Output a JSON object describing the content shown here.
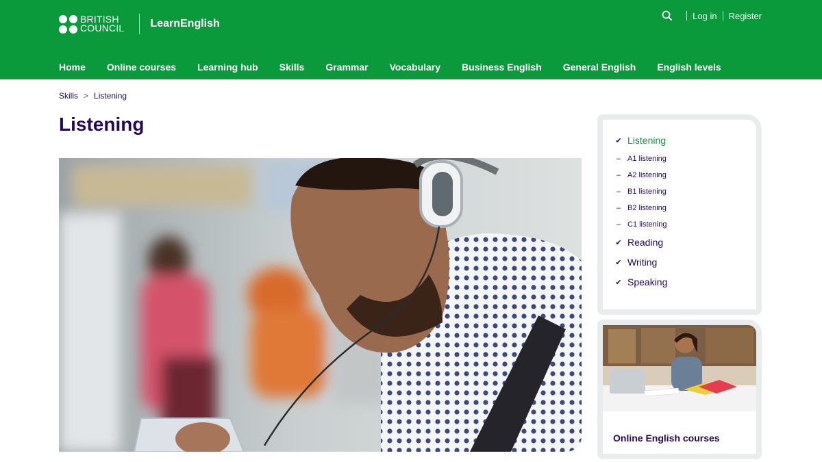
{
  "brand": {
    "logo_line1": "BRITISH",
    "logo_line2": "COUNCIL",
    "site_name": "LearnEnglish"
  },
  "topbar": {
    "login": "Log in",
    "register": "Register"
  },
  "nav": [
    "Home",
    "Online courses",
    "Learning hub",
    "Skills",
    "Grammar",
    "Vocabulary",
    "Business English",
    "General English",
    "English levels"
  ],
  "breadcrumb": {
    "parent": "Skills",
    "separator": ">",
    "current": "Listening"
  },
  "page": {
    "title": "Listening"
  },
  "sidebar": {
    "items": [
      {
        "label": "Listening",
        "type": "main",
        "active": true
      },
      {
        "label": "A1 listening",
        "type": "sub"
      },
      {
        "label": "A2 listening",
        "type": "sub"
      },
      {
        "label": "B1 listening",
        "type": "sub"
      },
      {
        "label": "B2 listening",
        "type": "sub"
      },
      {
        "label": "C1 listening",
        "type": "sub"
      },
      {
        "label": "Reading",
        "type": "main"
      },
      {
        "label": "Writing",
        "type": "main"
      },
      {
        "label": "Speaking",
        "type": "main"
      }
    ]
  },
  "promo": {
    "title": "Online English courses"
  },
  "colors": {
    "brand_green": "#0a9a3c",
    "navy": "#23085a",
    "card_border": "#e9ecec"
  }
}
